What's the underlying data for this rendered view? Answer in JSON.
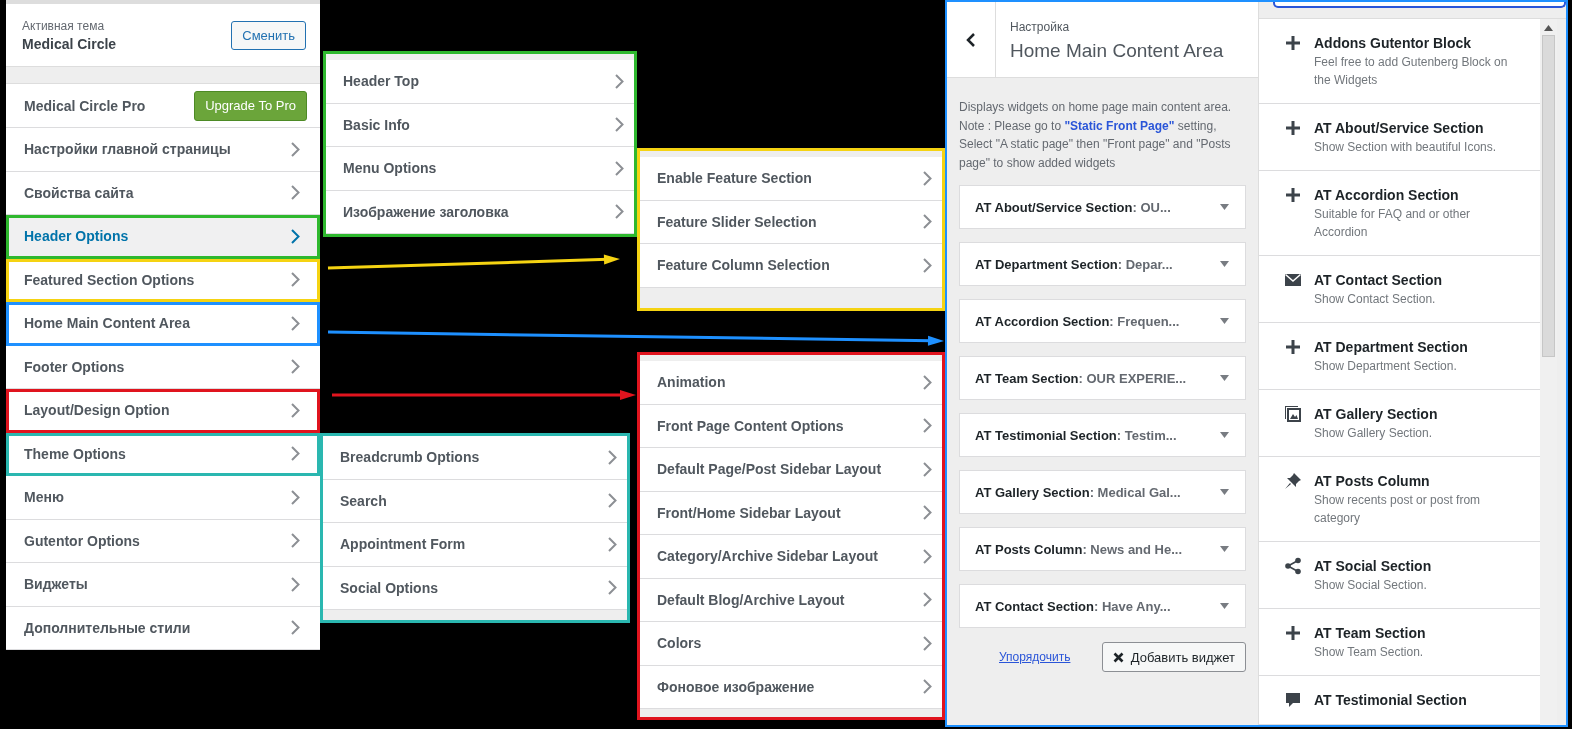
{
  "theme_header": {
    "label": "Активная тема",
    "name": "Medical Circle",
    "change_button": "Сменить"
  },
  "pro": {
    "title": "Medical Circle Pro",
    "button": "Upgrade To Pro"
  },
  "main_menu": [
    {
      "label": "Настройки главной страницы",
      "selected": false
    },
    {
      "label": "Свойства сайта",
      "selected": false
    },
    {
      "label": "Header Options",
      "selected": true,
      "color": "#2eb82e"
    },
    {
      "label": "Featured Section Options",
      "selected": false,
      "color": "#f5d312"
    },
    {
      "label": "Home Main Content Area",
      "selected": false,
      "color": "#1e90ff"
    },
    {
      "label": "Footer Options",
      "selected": false
    },
    {
      "label": "Layout/Design Option",
      "selected": false,
      "color": "#e0141e"
    },
    {
      "label": "Theme Options",
      "selected": false,
      "color": "#2ab7b0"
    },
    {
      "label": "Меню",
      "selected": false
    },
    {
      "label": "Gutentor Options",
      "selected": false
    },
    {
      "label": "Виджеты",
      "selected": false
    },
    {
      "label": "Дополнительные стили",
      "selected": false
    }
  ],
  "submenus": [
    {
      "color": "#2eb82e",
      "items": [
        "Header Top",
        "Basic Info",
        "Menu Options",
        "Изображение заголовка"
      ]
    },
    {
      "color": "#f5d312",
      "items": [
        "Enable Feature Section",
        "Feature Slider Selection",
        "Feature Column Selection"
      ]
    },
    {
      "color": "#2ab7b0",
      "items": [
        "Breadcrumb Options",
        "Search",
        "Appointment Form",
        "Social Options"
      ]
    },
    {
      "color": "#e0141e",
      "items": [
        "Animation",
        "Front Page Content Options",
        "Default Page/Post Sidebar Layout",
        "Front/Home Sidebar Layout",
        "Category/Archive Sidebar Layout",
        "Default Blog/Archive Layout",
        "Colors",
        "Фоновое изображение"
      ]
    }
  ],
  "section_panel": {
    "color": "#1e90ff",
    "breadcrumb": "Настройка",
    "title": "Home Main Content Area",
    "description": "Displays widgets on home page main content area.",
    "note": {
      "before": "Note : Please go to",
      "link": "\"Static Front Page\"",
      "after": "setting, Select \"A static page\" then \"Front page\" and \"Posts page\" to show added widgets"
    },
    "widgets": [
      {
        "title": "AT About/Service Section",
        "subtitle": ": OU..."
      },
      {
        "title": "AT Department Section",
        "subtitle": ": Depar..."
      },
      {
        "title": "AT Accordion Section",
        "subtitle": ": Frequen..."
      },
      {
        "title": "AT Team Section",
        "subtitle": ": OUR EXPERIE..."
      },
      {
        "title": "AT Testimonial Section",
        "subtitle": ": Testim..."
      },
      {
        "title": "AT Gallery Section",
        "subtitle": ": Medical Gal..."
      },
      {
        "title": "AT Posts Column",
        "subtitle": ": News and He..."
      },
      {
        "title": "AT Contact Section",
        "subtitle": ": Have Any..."
      }
    ],
    "reorder_link": "Упорядочить",
    "add_button": "Добавить виджет"
  },
  "available_widgets": [
    {
      "kind": "plus",
      "title": "Addons Gutentor Block",
      "description": "Feel free to add Gutenberg Block on the Widgets"
    },
    {
      "kind": "plus",
      "title": "AT About/Service Section",
      "description": "Show Section with beautiful Icons."
    },
    {
      "kind": "plus",
      "title": "AT Accordion Section",
      "description": "Suitable for FAQ and or other Accordion"
    },
    {
      "kind": "mail",
      "title": "AT Contact Section",
      "description": "Show Contact Section."
    },
    {
      "kind": "plus",
      "title": "AT Department Section",
      "description": "Show Department Section."
    },
    {
      "kind": "gallery",
      "title": "AT Gallery Section",
      "description": "Show Gallery Section."
    },
    {
      "kind": "pin",
      "title": "AT Posts Column",
      "description": "Show recents post or post from category"
    },
    {
      "kind": "share",
      "title": "AT Social Section",
      "description": "Show Social Section."
    },
    {
      "kind": "plus",
      "title": "AT Team Section",
      "description": "Show Team Section."
    },
    {
      "kind": "comment",
      "title": "AT Testimonial Section"
    }
  ]
}
